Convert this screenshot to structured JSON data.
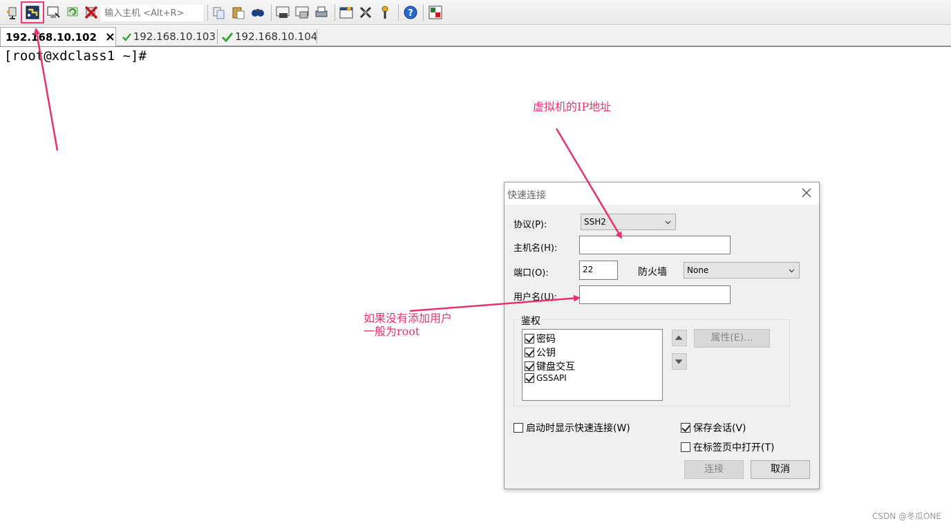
{
  "toolbar": {
    "host_input_placeholder": "输入主机 <Alt+R>",
    "icons": [
      "connect-icon",
      "quick-connect-icon",
      "connect-in-tab-icon",
      "reconnect-icon",
      "disconnect-icon",
      "copy-icon",
      "paste-icon",
      "find-icon",
      "print-setup-icon",
      "print-selection-icon",
      "print-icon",
      "session-options-icon",
      "global-options-icon",
      "keymap-icon",
      "help-icon",
      "sftp-icon"
    ]
  },
  "tabs": [
    {
      "label": "192.168.10.102",
      "active": true
    },
    {
      "label": "192.168.10.103",
      "active": false
    },
    {
      "label": "192.168.10.104",
      "active": false
    }
  ],
  "terminal": {
    "prompt": "[root@xdclass1 ~]#"
  },
  "annotations": {
    "ip_note": "虚拟机的IP地址",
    "user_note_line1": "如果没有添加用户",
    "user_note_line2": "一般为root"
  },
  "dialog": {
    "title": "快速连接",
    "protocol_label": "协议(P):",
    "protocol_value": "SSH2",
    "hostname_label": "主机名(H):",
    "hostname_value": "",
    "port_label": "端口(O):",
    "port_value": "22",
    "firewall_label": "防火墙",
    "firewall_value": "None",
    "username_label": "用户名(U):",
    "username_value": "",
    "auth_group_label": "鉴权",
    "auth_methods": [
      {
        "label": "密码",
        "checked": true
      },
      {
        "label": "公钥",
        "checked": true
      },
      {
        "label": "键盘交互",
        "checked": true
      },
      {
        "label": "GSSAPI",
        "checked": true
      }
    ],
    "properties_button": "属性(E)...",
    "show_on_startup_label": "启动时显示快速连接(W)",
    "show_on_startup_checked": false,
    "save_session_label": "保存会话(V)",
    "save_session_checked": true,
    "open_in_tab_label": "在标签页中打开(T)",
    "open_in_tab_checked": false,
    "connect_button": "连接",
    "cancel_button": "取消"
  },
  "watermark": "CSDN @冬瓜ONE",
  "colors": {
    "annotation": "#e8306e",
    "accent_check": "#3aa23a"
  }
}
